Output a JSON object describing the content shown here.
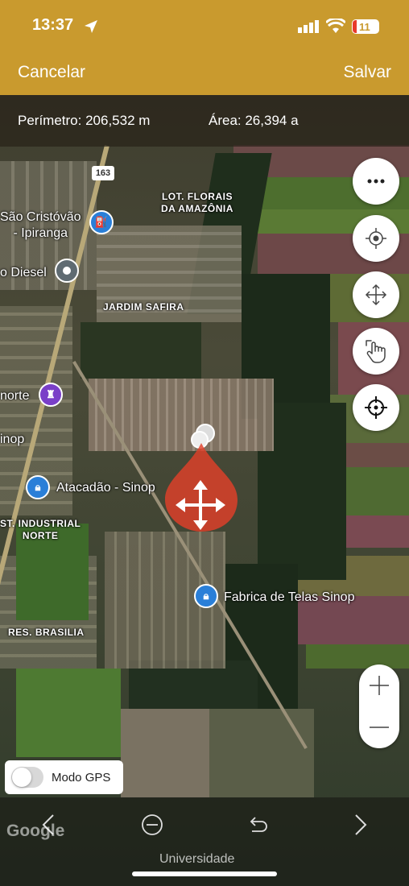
{
  "status_bar": {
    "time": "13:37",
    "battery": "11"
  },
  "nav": {
    "cancel": "Cancelar",
    "save": "Salvar"
  },
  "info": {
    "perimeter": "Perímetro: 206,532 m",
    "area": "Área: 26,394 a"
  },
  "map": {
    "road_shield": "163",
    "labels": {
      "lot_florais": "LOT. FLORAIS\nDA AMAZÔNIA",
      "jardim_safira": "JARDIM SAFIRA",
      "industrial": "ST. INDUSTRIAL\nNORTE",
      "res_brasilia": "RES. BRASILIA"
    },
    "pois": {
      "sao_cristovao": "São Cristóvão\n- Ipiranga",
      "diesel": "o Diesel",
      "norte": "norte",
      "sinop": "inop",
      "atacadao": "Atacadão - Sinop",
      "fabrica": "Fabrica de Telas Sinop"
    },
    "attribution": "Google",
    "bottom_text": "Universidade"
  },
  "controls": {
    "more_icon": "more-icon",
    "locate_icon": "locate-icon",
    "move_icon": "move-icon",
    "touch_icon": "touch-icon",
    "crosshair_icon": "crosshair-icon"
  },
  "gps": {
    "label": "Modo GPS",
    "enabled": false
  },
  "colors": {
    "accent": "#c99a2e",
    "polygon": "#e0402a",
    "pin_blue": "#2a7fd8",
    "pin_purple": "#7a3fc8"
  }
}
